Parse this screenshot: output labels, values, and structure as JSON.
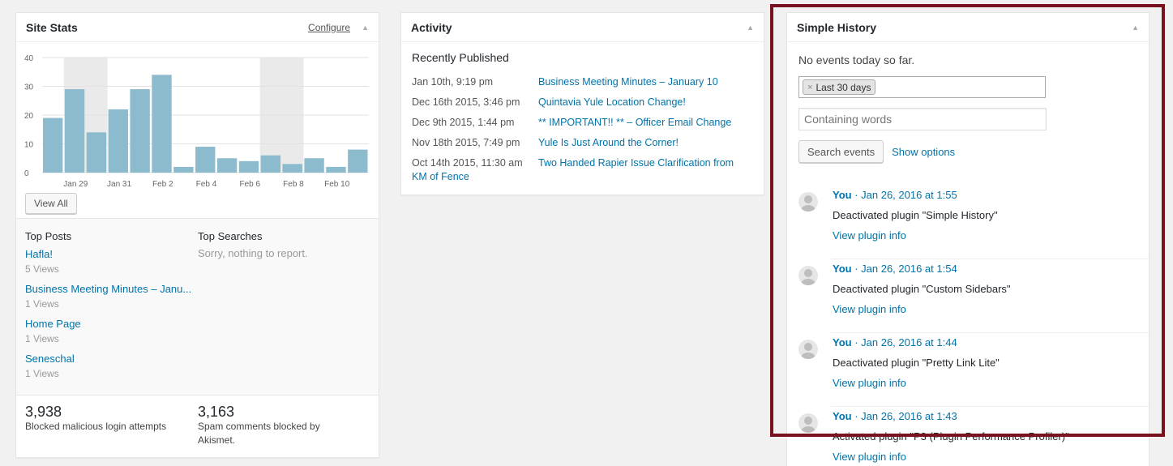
{
  "site_stats": {
    "title": "Site Stats",
    "configure_label": "Configure",
    "toggle_icon": "triangle-up-icon",
    "view_all_label": "View All",
    "top_posts_heading": "Top Posts",
    "top_searches_heading": "Top Searches",
    "top_searches_empty": "Sorry, nothing to report.",
    "top_posts": [
      {
        "title": "Hafla!",
        "views": "5 Views"
      },
      {
        "title": "Business Meeting Minutes – Janu...",
        "views": "1 Views"
      },
      {
        "title": "Home Page",
        "views": "1 Views"
      },
      {
        "title": "Seneschal",
        "views": "1 Views"
      }
    ],
    "blocked_logins": {
      "number": "3,938",
      "label": "Blocked malicious login attempts"
    },
    "spam_blocked": {
      "number": "3,163",
      "label": "Spam comments blocked by Akismet."
    }
  },
  "chart_data": {
    "type": "bar",
    "values": [
      19,
      29,
      14,
      22,
      29,
      34,
      2,
      9,
      5,
      4,
      6,
      3,
      5,
      2,
      8
    ],
    "tick_labels": [
      "Jan 29",
      "Jan 31",
      "Feb 2",
      "Feb 4",
      "Feb 6",
      "Feb 8",
      "Feb 10"
    ],
    "y_ticks": [
      "0",
      "10",
      "20",
      "30",
      "40"
    ],
    "ylim": [
      0,
      40
    ],
    "bar_color": "#8dbbce",
    "shaded_color": "#eaeaea",
    "grid": true
  },
  "activity": {
    "title": "Activity",
    "recently_published": "Recently Published",
    "items": [
      {
        "date": "Jan 10th, 9:19 pm",
        "title": "Business Meeting Minutes – January 10"
      },
      {
        "date": "Dec 16th 2015, 3:46 pm",
        "title": "Quintavia Yule Location Change!"
      },
      {
        "date": "Dec 9th 2015, 1:44 pm",
        "title": "** IMPORTANT!! ** – Officer Email Change"
      },
      {
        "date": "Nov 18th 2015, 7:49 pm",
        "title": "Yule Is Just Around the Corner!"
      },
      {
        "date": "Oct 14th 2015, 11:30 am",
        "title": "Two Handed Rapier Issue Clarification from"
      },
      {
        "date": "",
        "title": "KM of Fence"
      }
    ]
  },
  "simple_history": {
    "title": "Simple History",
    "no_events": "No events today so far.",
    "date_chip": "Last 30 days",
    "chip_remove": "×",
    "search_placeholder": "Containing words",
    "search_button": "Search events",
    "show_options": "Show options",
    "events": [
      {
        "user": "You",
        "when": " · Jan 26, 2016 at 1:55",
        "message": "Deactivated plugin \"Simple History\"",
        "link": "View plugin info"
      },
      {
        "user": "You",
        "when": " · Jan 26, 2016 at 1:54",
        "message": "Deactivated plugin \"Custom Sidebars\"",
        "link": "View plugin info"
      },
      {
        "user": "You",
        "when": " · Jan 26, 2016 at 1:44",
        "message": "Deactivated plugin \"Pretty Link Lite\"",
        "link": "View plugin info"
      },
      {
        "user": "You",
        "when": " · Jan 26, 2016 at 1:43",
        "message": "Activated plugin \"P3 (Plugin Performance Profiler)\"",
        "link": "View plugin info"
      }
    ]
  },
  "colors": {
    "link": "#0073aa",
    "highlight_frame": "#7a1320"
  }
}
